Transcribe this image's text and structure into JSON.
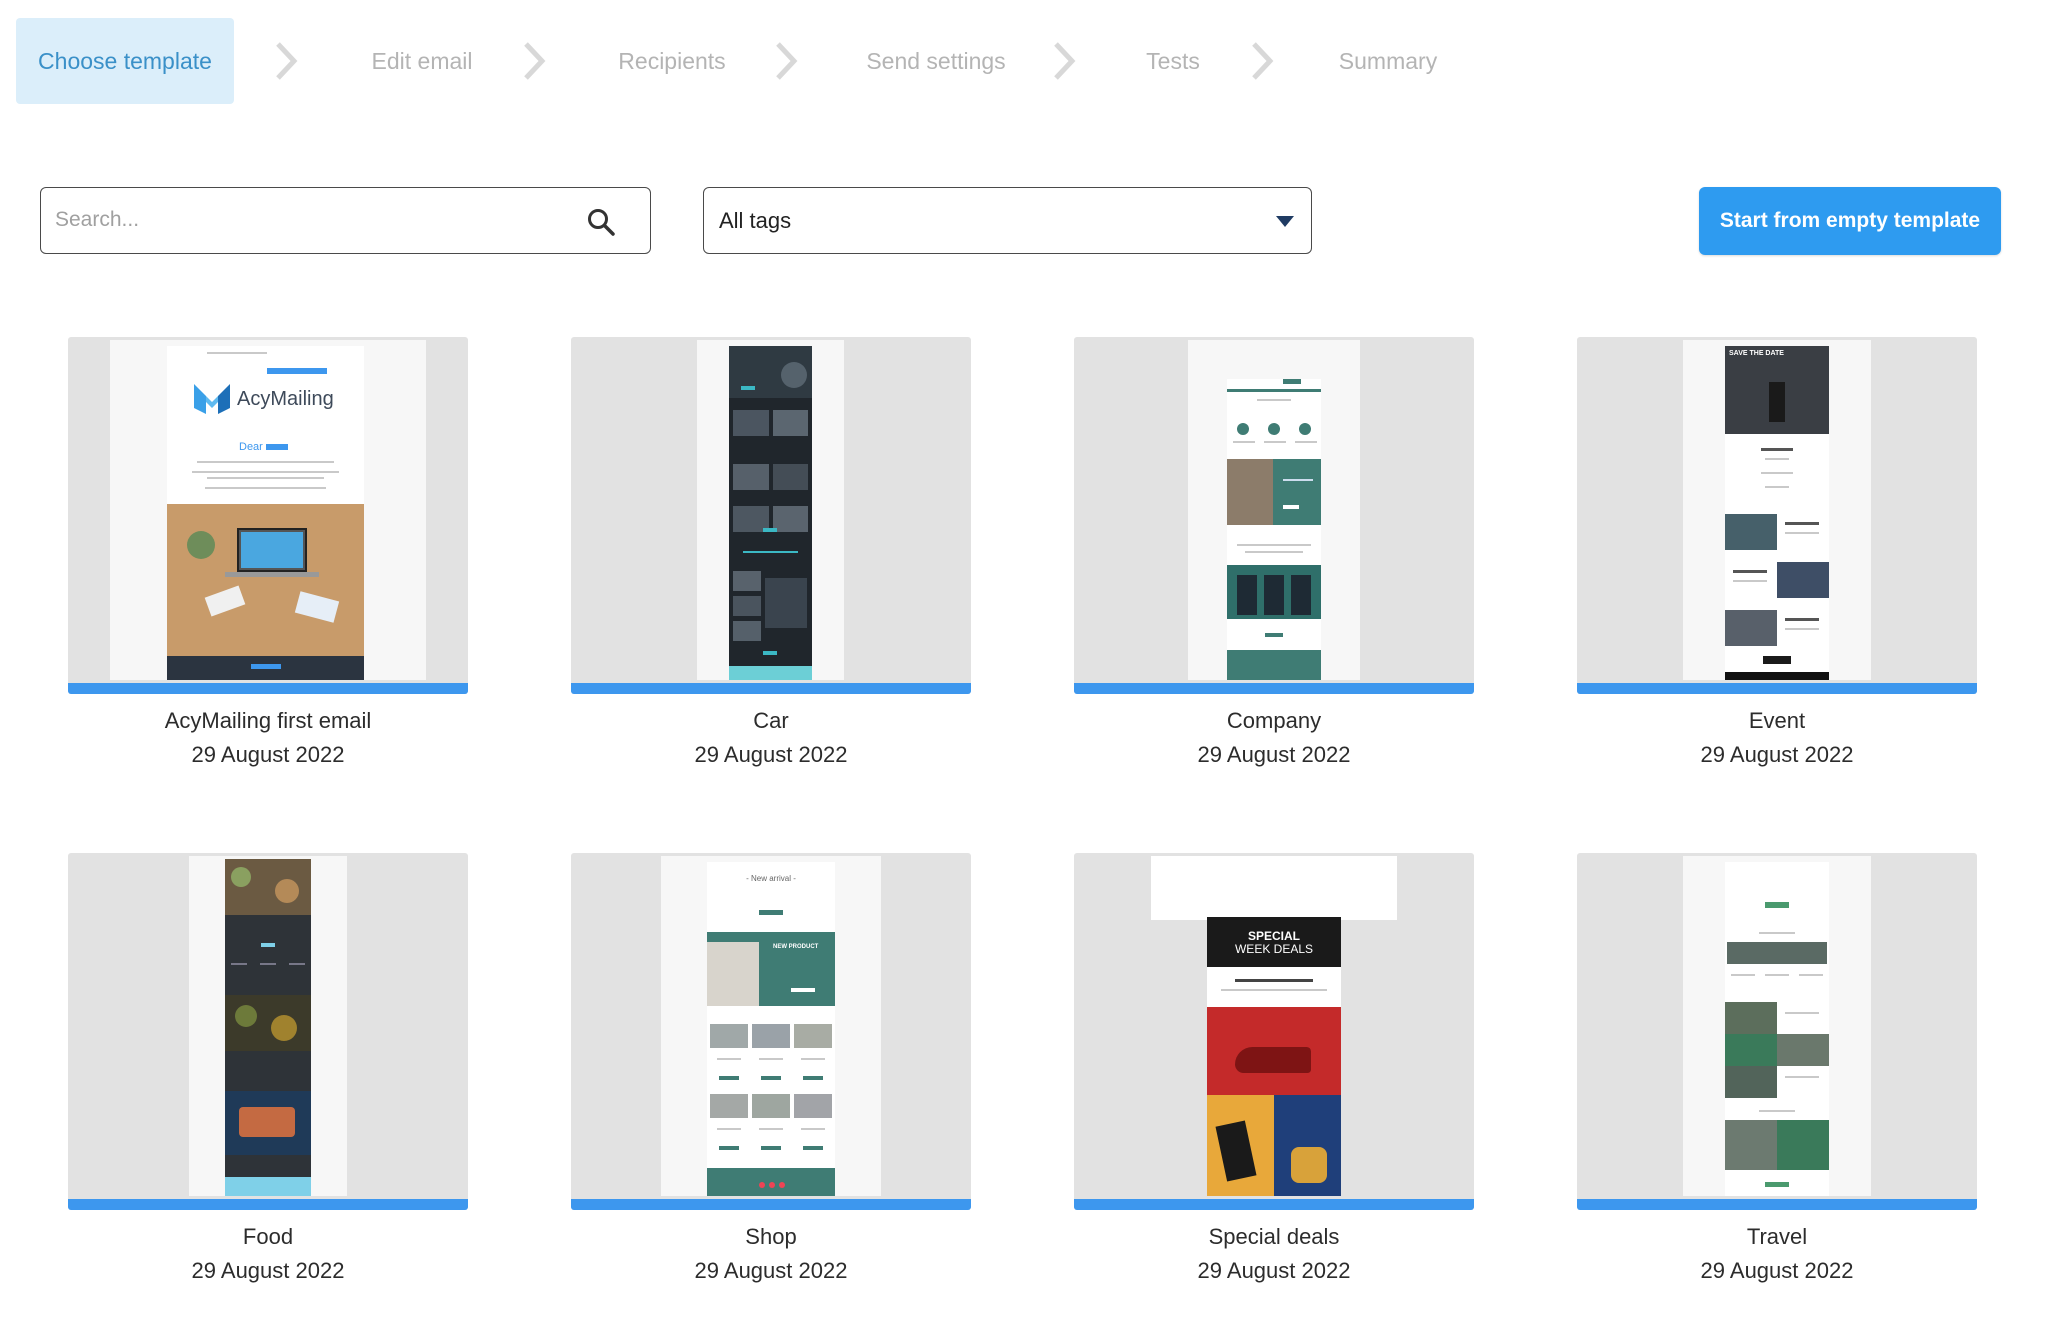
{
  "stepper": {
    "steps": [
      {
        "label": "Choose template",
        "active": true
      },
      {
        "label": "Edit email",
        "active": false
      },
      {
        "label": "Recipients",
        "active": false
      },
      {
        "label": "Send settings",
        "active": false
      },
      {
        "label": "Tests",
        "active": false
      },
      {
        "label": "Summary",
        "active": false
      }
    ]
  },
  "toolbar": {
    "search_placeholder": "Search...",
    "search_value": "",
    "tags_selected": "All tags",
    "empty_template_label": "Start from empty template"
  },
  "thumbnail_text": {
    "acymailing_logo": "AcyMailing",
    "acymailing_greeting": "Dear",
    "event_header": "SAVE THE DATE",
    "shop_header": "- New arrival -",
    "shop_banner": "NEW PRODUCT",
    "deals_header_1": "SPECIAL",
    "deals_header_2": "WEEK DEALS"
  },
  "templates": [
    {
      "name": "AcyMailing first email",
      "date": "29 August 2022"
    },
    {
      "name": "Car",
      "date": "29 August 2022"
    },
    {
      "name": "Company",
      "date": "29 August 2022"
    },
    {
      "name": "Event",
      "date": "29 August 2022"
    },
    {
      "name": "Food",
      "date": "29 August 2022"
    },
    {
      "name": "Shop",
      "date": "29 August 2022"
    },
    {
      "name": "Special deals",
      "date": "29 August 2022"
    },
    {
      "name": "Travel",
      "date": "29 August 2022"
    }
  ],
  "colors": {
    "accent": "#2e9bf0",
    "thumb_bar": "#3d97ee",
    "active_step_bg": "#dbeefa",
    "active_step_text": "#3a90c8",
    "inactive_step_text": "#b4b4b4",
    "company_teal": "#3f7c74",
    "event_dark": "#1a1a1a",
    "deals_red": "#c42a2a"
  }
}
